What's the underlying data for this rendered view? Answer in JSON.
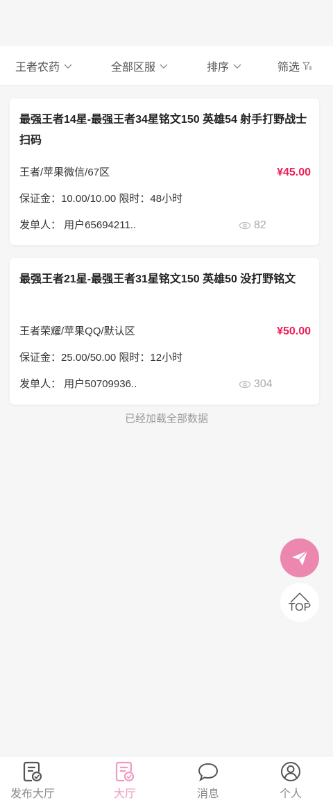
{
  "filters": [
    {
      "label": "王者农药"
    },
    {
      "label": "全部区服"
    },
    {
      "label": "排序"
    },
    {
      "label": "筛选"
    }
  ],
  "orders": [
    {
      "title": "最强王者14星-最强王者34星铭文150 英雄54 射手打野战士扫码",
      "server": "王者/苹果微信/67区",
      "price": "¥45.00",
      "deposit": "保证金：10.00/10.00 限时：48小时",
      "publisher": "发单人：  用户65694211..",
      "views": "82"
    },
    {
      "title": "最强王者21星-最强王者31星铭文150 英雄50 没打野铭文",
      "server": "王者荣耀/苹果QQ/默认区",
      "price": "¥50.00",
      "deposit": "保证金：25.00/50.00 限时：12小时",
      "publisher": "发单人：  用户50709936..",
      "views": "304"
    }
  ],
  "status": {
    "loaded_all": "已经加载全部数据"
  },
  "fab": {
    "top_label": "TOP",
    "send_icon": "paper-plane-icon"
  },
  "tabbar": {
    "tabs": [
      {
        "label": "发布大厅",
        "icon": "publish-doc-icon",
        "active": false
      },
      {
        "label": "大厅",
        "icon": "hall-doc-icon",
        "active": true
      },
      {
        "label": "消息",
        "icon": "chat-bubble-icon",
        "active": false
      },
      {
        "label": "个人",
        "icon": "user-icon",
        "active": false
      }
    ]
  },
  "colors": {
    "accent": "#ec88b0",
    "tab_active": "#f09ac0",
    "price": "#ee1e56",
    "background": "#f6f6f6"
  }
}
